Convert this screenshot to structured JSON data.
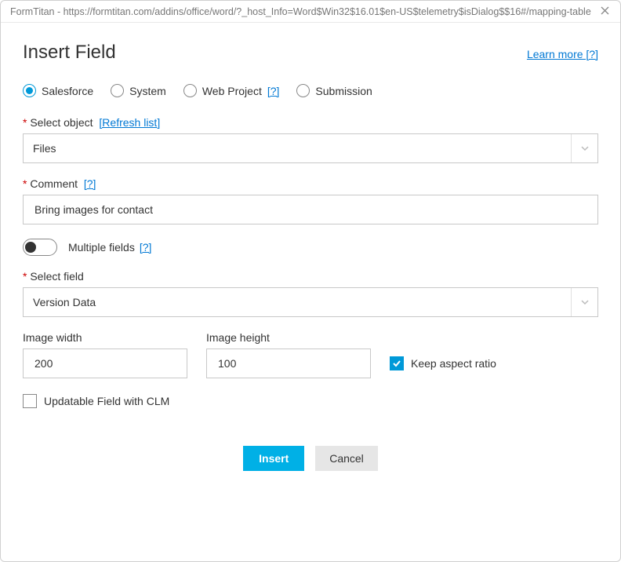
{
  "titlebar": {
    "text": "FormTitan - https://formtitan.com/addins/office/word/?_host_Info=Word$Win32$16.01$en-US$telemetry$isDialog$$16#/mapping-table"
  },
  "header": {
    "title": "Insert Field",
    "learn_more": "Learn more [?]"
  },
  "source_radios": {
    "salesforce": "Salesforce",
    "system": "System",
    "web_project": "Web Project",
    "web_project_help": "[?]",
    "submission": "Submission"
  },
  "select_object": {
    "label": "Select object",
    "refresh": "[Refresh list]",
    "value": "Files"
  },
  "comment": {
    "label": "Comment",
    "help": "[?]",
    "value": "Bring images for contact"
  },
  "multiple_fields": {
    "label": "Multiple fields",
    "help": "[?]"
  },
  "select_field": {
    "label": "Select field",
    "value": "Version Data"
  },
  "image_width": {
    "label": "Image width",
    "value": "200"
  },
  "image_height": {
    "label": "Image height",
    "value": "100"
  },
  "keep_aspect": {
    "label": "Keep aspect ratio"
  },
  "updatable_clm": {
    "label": "Updatable Field with CLM"
  },
  "buttons": {
    "insert": "Insert",
    "cancel": "Cancel"
  }
}
